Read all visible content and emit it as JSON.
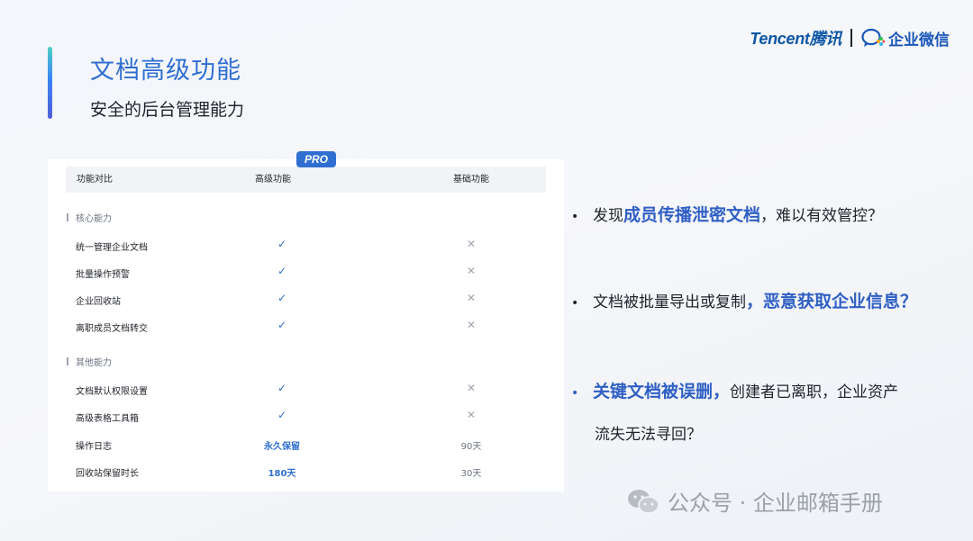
{
  "header": {
    "title": "文档高级功能",
    "subtitle": "安全的后台管理能力",
    "brand_tencent": "Tencent腾讯",
    "brand_wecom": "企业微信"
  },
  "table": {
    "badge": "PRO",
    "columns": [
      "功能对比",
      "高级功能",
      "基础功能"
    ],
    "sections": [
      {
        "label": "核心能力",
        "rows": [
          {
            "name": "统一管理企业文档",
            "advanced": "✓",
            "basic": "✕"
          },
          {
            "name": "批量操作预警",
            "advanced": "✓",
            "basic": "✕"
          },
          {
            "name": "企业回收站",
            "advanced": "✓",
            "basic": "✕"
          },
          {
            "name": "离职成员文档转交",
            "advanced": "✓",
            "basic": "✕"
          }
        ]
      },
      {
        "label": "其他能力",
        "rows": [
          {
            "name": "文档默认权限设置",
            "advanced": "✓",
            "basic": "✕"
          },
          {
            "name": "高级表格工具箱",
            "advanced": "✓",
            "basic": "✕"
          },
          {
            "name": "操作日志",
            "advanced": "永久保留",
            "basic": "90天"
          },
          {
            "name": "回收站保留时长",
            "advanced": "180天",
            "basic": "30天"
          }
        ]
      }
    ]
  },
  "bullets": [
    {
      "prefix": "发现",
      "highlight": "成员传播泄密文档",
      "suffix": "，难以有效管控？"
    },
    {
      "prefix": "文档被批量导出或复制",
      "highlight": "，恶意获取企业信息？",
      "suffix": ""
    },
    {
      "prefix": "",
      "highlight": "关键文档被误删，",
      "suffix": "创建者已离职，企业资产",
      "continuation": "流失无法寻回？"
    }
  ],
  "watermark": "公众号 · 企业邮箱手册",
  "colors": {
    "accent": "#2f6fd1",
    "highlight": "#2f5fc4",
    "cross": "#a0a6b0"
  }
}
